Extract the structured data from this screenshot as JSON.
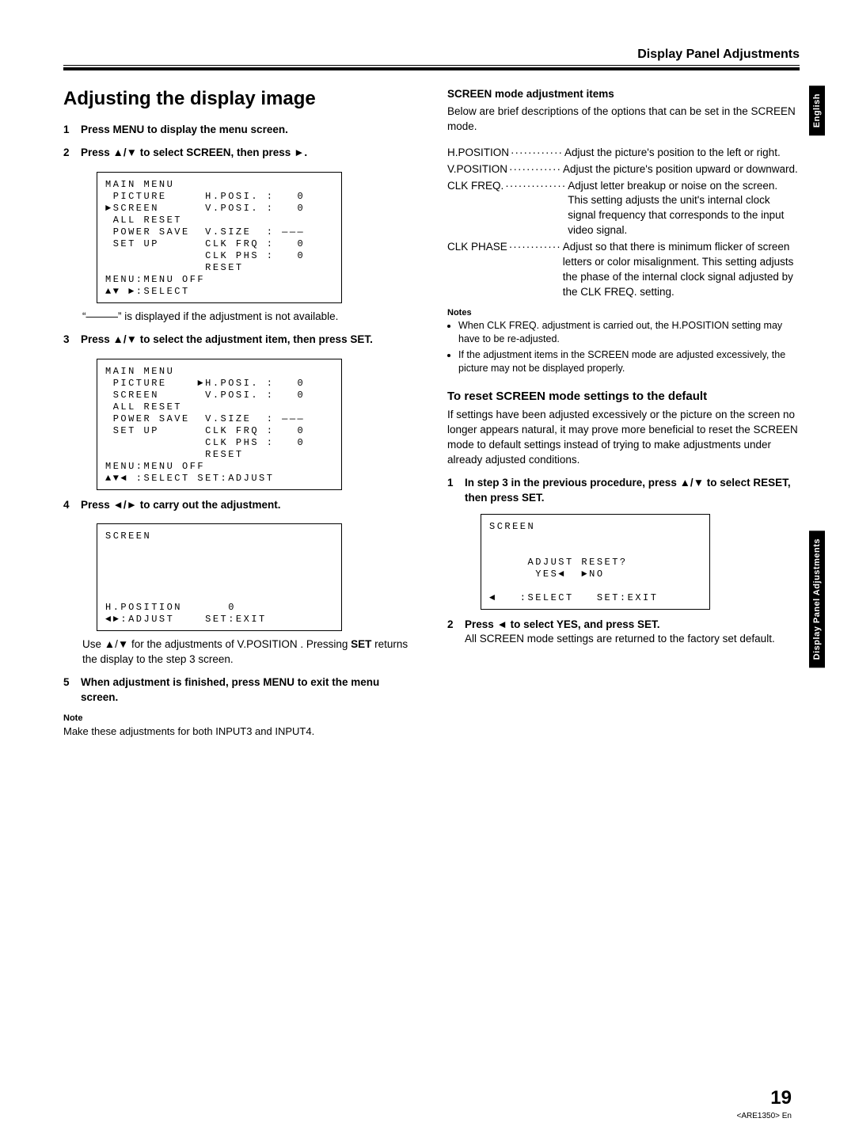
{
  "header": {
    "title": "Display Panel Adjustments"
  },
  "side_tabs": {
    "english": "English",
    "section": "Display Panel Adjustments"
  },
  "left": {
    "h1": "Adjusting the display image",
    "step1": "Press MENU to display the menu screen.",
    "step2": "Press ▲/▼ to select SCREEN, then press ►.",
    "osd1": "MAIN MENU\n PICTURE     H.POSI. :   0\n►SCREEN      V.POSI. :   0\n ALL RESET\n POWER SAVE  V.SIZE  : ———\n SET UP      CLK FRQ :   0\n             CLK PHS :   0\n             RESET\nMENU:MENU OFF\n▲▼ ►:SELECT",
    "not_available": "“———” is displayed if the adjustment is not available.",
    "step3": "Press ▲/▼ to select the adjustment item, then press SET.",
    "osd2": "MAIN MENU\n PICTURE    ►H.POSI. :   0\n SCREEN      V.POSI. :   0\n ALL RESET\n POWER SAVE  V.SIZE  : ———\n SET UP      CLK FRQ :   0\n             CLK PHS :   0\n             RESET\nMENU:MENU OFF\n▲▼◄ :SELECT SET:ADJUST",
    "step4": "Press ◄/► to carry out the adjustment.",
    "osd3": "SCREEN\n\n\n\n\n\nH.POSITION      0\n◄►:ADJUST    SET:EXIT",
    "para_use": "Use ▲/▼ for the adjustments of V.POSITION . Pressing ",
    "para_use_set": "SET",
    "para_use_after": " returns the display to the step 3 screen.",
    "step5": "When adjustment is finished, press MENU to exit the menu screen.",
    "note_head": "Note",
    "note_text": "Make these adjustments for both INPUT3 and INPUT4."
  },
  "right": {
    "items_head": "SCREEN mode adjustment items",
    "items_intro": "Below are brief descriptions of the options that can be set in the SCREEN mode.",
    "table": [
      {
        "label": "H.POSITION",
        "dots": "············",
        "text": "Adjust the picture's position to the left or right."
      },
      {
        "label": "V.POSITION",
        "dots": "············",
        "text": "Adjust the picture's position upward or downward."
      },
      {
        "label": "CLK FREQ.",
        "dots": "··············",
        "text": "Adjust letter breakup or noise on the screen. This setting adjusts the unit's internal clock signal frequency that corresponds to the input video signal."
      },
      {
        "label": "CLK PHASE",
        "dots": "············",
        "text": "Adjust so that there is minimum flicker of screen letters or color misalignment. This setting adjusts the phase of the internal clock signal adjusted by the CLK FREQ. setting."
      }
    ],
    "notes_head": "Notes",
    "notes": [
      "When CLK FREQ. adjustment is carried out, the H.POSITION setting may have to be re-adjusted.",
      "If the adjustment items in the SCREEN mode are adjusted excessively, the picture may not be displayed properly."
    ],
    "reset_head": "To reset SCREEN mode settings to the default",
    "reset_intro": "If settings have been adjusted excessively or the picture on the screen no longer appears natural, it may prove more beneficial to reset the SCREEN mode to default settings instead of trying to make adjustments under already adjusted conditions.",
    "reset_step1": "In step 3 in the previous procedure, press ▲/▼ to select RESET, then press SET.",
    "osd_reset": "SCREEN\n\n\n     ADJUST RESET?\n      YES◄  ►NO\n\n◄   :SELECT   SET:EXIT",
    "reset_step2_a": "Press ◄ to select YES, and press SET.",
    "reset_step2_b": "All SCREEN mode settings are returned to the factory set default."
  },
  "footer": {
    "page": "19",
    "code": "<ARE1350> En"
  }
}
